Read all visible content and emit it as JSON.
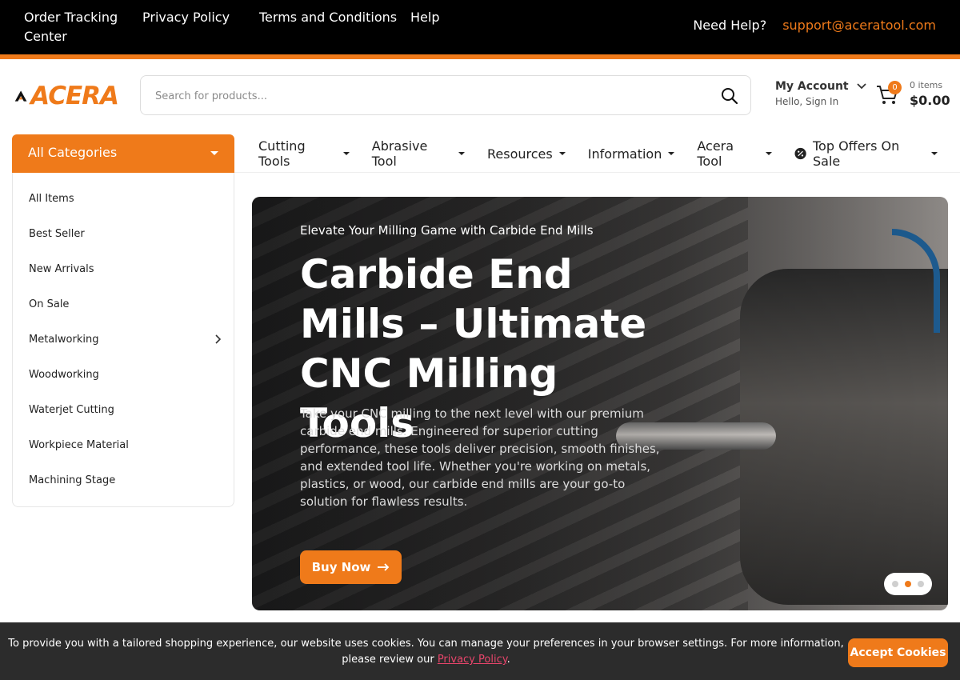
{
  "topbar": {
    "links": [
      "Order Tracking Center",
      "Privacy Policy",
      "Terms and Conditions",
      "Help"
    ],
    "help_label": "Need Help?",
    "help_email": "support@aceratool.com"
  },
  "header": {
    "logo_text": "ACERA",
    "search_placeholder": "Search for products...",
    "account_title": "My Account",
    "account_sub": "Hello, Sign In",
    "cart_count": "0",
    "cart_items": "0 items",
    "cart_total": "$0.00"
  },
  "nav": {
    "all_categories": "All Categories",
    "items": [
      "Cutting Tools",
      "Abrasive Tool",
      "Resources",
      "Information",
      "Acera Tool",
      "Top Offers On Sale"
    ]
  },
  "sidebar": {
    "items": [
      "All Items",
      "Best Seller",
      "New Arrivals",
      "On Sale",
      "Metalworking",
      "Woodworking",
      "Waterjet Cutting",
      "Workpiece Material",
      "Machining Stage"
    ]
  },
  "hero": {
    "kicker": "Elevate Your Milling Game with Carbide End Mills",
    "title": "Carbide End Mills – Ultimate CNC Milling Tools",
    "description": "Take your CNC milling to the next level with our premium carbide end mills. Engineered for superior cutting performance, these tools deliver precision, smooth finishes, and extended tool life. Whether you're working on metals, plastics, or wood, our carbide end mills are your go-to solution for flawless results.",
    "button": "Buy Now",
    "active_slide": 2,
    "slide_count": 3
  },
  "cookie": {
    "text_before": "To provide you with a tailored shopping experience, our website uses cookies. You can manage your preferences in your browser settings. For more information, please review our ",
    "link": "Privacy Policy",
    "text_after": ".",
    "accept": "Accept Cookies"
  },
  "colors": {
    "accent": "#ef7a1a",
    "topbar": "#000000",
    "cookie_bar": "#2c2c2c",
    "link_pink": "#e8456b"
  }
}
